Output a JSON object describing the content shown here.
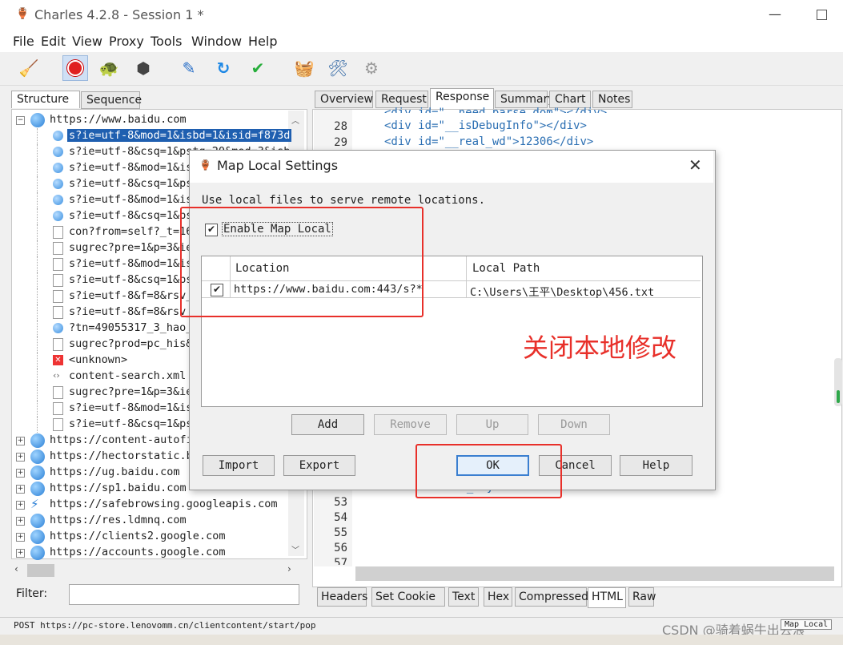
{
  "window": {
    "title": "Charles 4.2.8 - Session 1 *"
  },
  "menu": [
    "File",
    "Edit",
    "View",
    "Proxy",
    "Tools",
    "Window",
    "Help"
  ],
  "toolbar": {
    "icons": [
      "broom-icon",
      "record-icon",
      "turtle-icon",
      "stop-icon",
      "pen-icon",
      "refresh-icon",
      "check-icon",
      "basket-icon",
      "tools-icon",
      "gear-icon"
    ]
  },
  "left_tabs": [
    "Structure",
    "Sequence"
  ],
  "tree": {
    "root": "https://www.baidu.com",
    "children": [
      "s?ie=utf-8&mod=1&isbd=1&isid=f873d",
      "s?ie=utf-8&csq=1&pstg=20&mod=3&isb",
      "s?ie=utf-8&mod=1&is",
      "s?ie=utf-8&csq=1&ps",
      "s?ie=utf-8&mod=1&is",
      "s?ie=utf-8&csq=1&ps",
      "con?from=self?_t=16",
      "sugrec?pre=1&p=3&ie",
      "s?ie=utf-8&mod=1&is",
      "s?ie=utf-8&csq=1&ps",
      "s?ie=utf-8&f=8&rsv_",
      "s?ie=utf-8&f=8&rsv_",
      "?tn=49055317_3_hao_",
      "sugrec?prod=pc_his&",
      "<unknown>",
      "content-search.xml",
      "sugrec?pre=1&p=3&ie",
      "s?ie=utf-8&mod=1&is",
      "s?ie=utf-8&csq=1&ps"
    ],
    "hosts": [
      "https://content-autofi",
      "https://hectorstatic.b",
      "https://ug.baidu.com",
      "https://sp1.baidu.com",
      "https://safebrowsing.googleapis.com",
      "https://res.ldmnq.com",
      "https://clients2.google.com",
      "https://accounts.google.com"
    ]
  },
  "filter_label": "Filter:",
  "right_tabs": [
    "Overview",
    "Request",
    "Response",
    "Summary",
    "Chart",
    "Notes"
  ],
  "code": {
    "lines_top": [
      {
        "n": "28",
        "pre": "<div id=",
        "str": "\"__isDebugInfo\"",
        "post": "></div>"
      },
      {
        "n": "29",
        "pre": "<div id=",
        "str": "\"__real_wd\"",
        "post": ">12306</div>"
      }
    ],
    "partial_top": "<div id=\"__need_parse_dom\"></div>",
    "partial_bottom": "<div id=\"content_style\">",
    "line_numbers_bottom": [
      "52",
      "53",
      "54",
      "55",
      "56",
      "57"
    ]
  },
  "bottom_tabs": [
    "Headers",
    "Set Cookie",
    "Text",
    "Hex",
    "Compressed",
    "HTML",
    "Raw"
  ],
  "status": {
    "text": "POST https://pc-store.lenovomm.cn/clientcontent/start/pop",
    "badge": "Map Local"
  },
  "dialog": {
    "title": "Map Local Settings",
    "description": "Use local files to serve remote locations.",
    "enable_label": "Enable Map Local",
    "columns": [
      "Location",
      "Local Path"
    ],
    "rows": [
      {
        "location": "https://www.baidu.com:443/s?*",
        "local_path": "C:\\Users\\王平\\Desktop\\456.txt"
      }
    ],
    "buttons": {
      "add": "Add",
      "remove": "Remove",
      "up": "Up",
      "down": "Down",
      "import": "Import",
      "export": "Export",
      "ok": "OK",
      "cancel": "Cancel",
      "help": "Help"
    }
  },
  "annotation": "关闭本地修改",
  "watermark": "CSDN @骑着蜗牛出去浪",
  "colors": {
    "annotation": "#e8302a",
    "accent": "#3b7fd0"
  }
}
